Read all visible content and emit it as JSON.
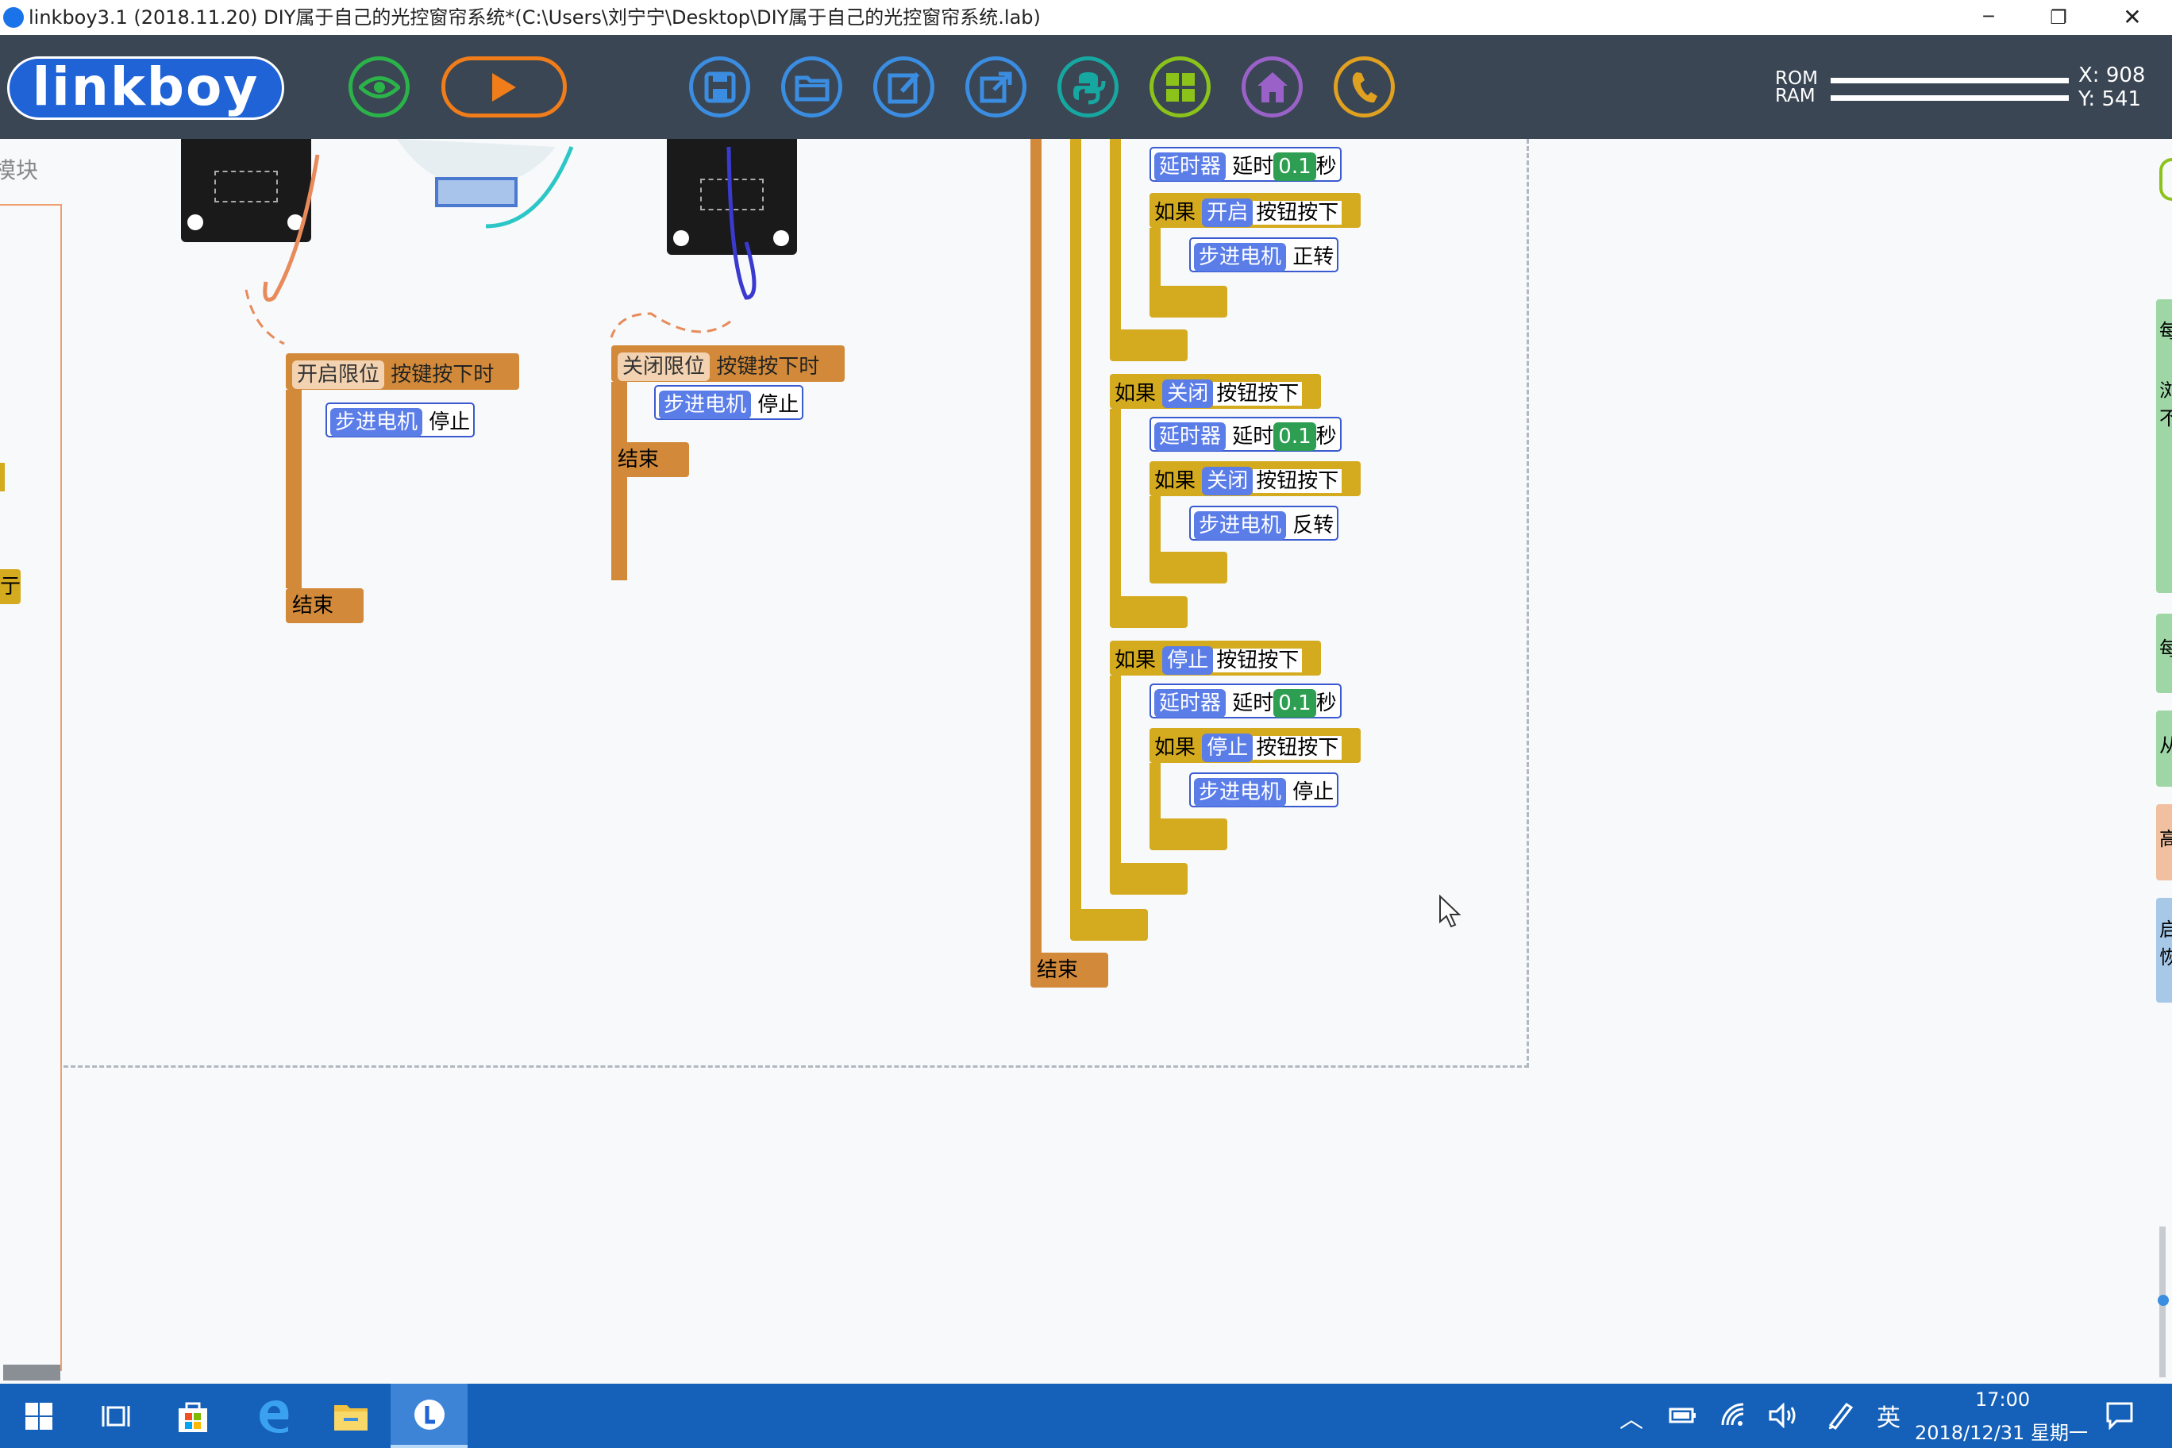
{
  "window": {
    "title": "linkboy3.1 (2018.11.20) DIY属于自己的光控窗帘系统*(C:\\Users\\刘宁宁\\Desktop\\DIY属于自己的光控窗帘系统.lab)",
    "minimize_glyph": "─",
    "restore_glyph": "❐",
    "close_glyph": "✕"
  },
  "toolbar": {
    "logo": "linkboy",
    "buttons": [
      "eye-icon",
      "play-icon",
      "save-icon",
      "open-folder-icon",
      "edit-icon",
      "export-icon",
      "python-icon",
      "grid-icon",
      "home-icon",
      "phone-icon"
    ],
    "rom_label": "ROM",
    "ram_label": "RAM",
    "rom_usage": 0.1,
    "ram_usage": 0.1,
    "x_readout": "X: 908",
    "y_readout": "Y: 541"
  },
  "canvas": {
    "left_label_partial": "模块",
    "left_tag_partial": "亍",
    "open_limit_event": {
      "name": "开启限位",
      "event": "按键按下时",
      "body_module": "步进电机",
      "body_action": "停止",
      "end": "结束"
    },
    "close_limit_event": {
      "name": "关闭限位",
      "event": "按键按下时",
      "body_module": "步进电机",
      "body_action": "停止",
      "end": "结束"
    },
    "main_code": {
      "if_label": "如果",
      "pressed_label": "按钮按下",
      "timer_module": "延时器",
      "delay_label": "延时",
      "delay_value": "0.1",
      "sec_label": "秒",
      "motor_module": "步进电机",
      "groups": [
        {
          "button": "开启",
          "action": "正转"
        },
        {
          "button": "关闭",
          "action": "反转"
        },
        {
          "button": "停止",
          "action": "停止"
        }
      ],
      "end": "结束"
    },
    "right_tabs_partial": [
      "每",
      "浏不",
      "每",
      "从",
      "高",
      "启恢"
    ]
  },
  "taskbar": {
    "ime": "英",
    "time": "17:00",
    "date": "2018/12/31 星期一"
  }
}
